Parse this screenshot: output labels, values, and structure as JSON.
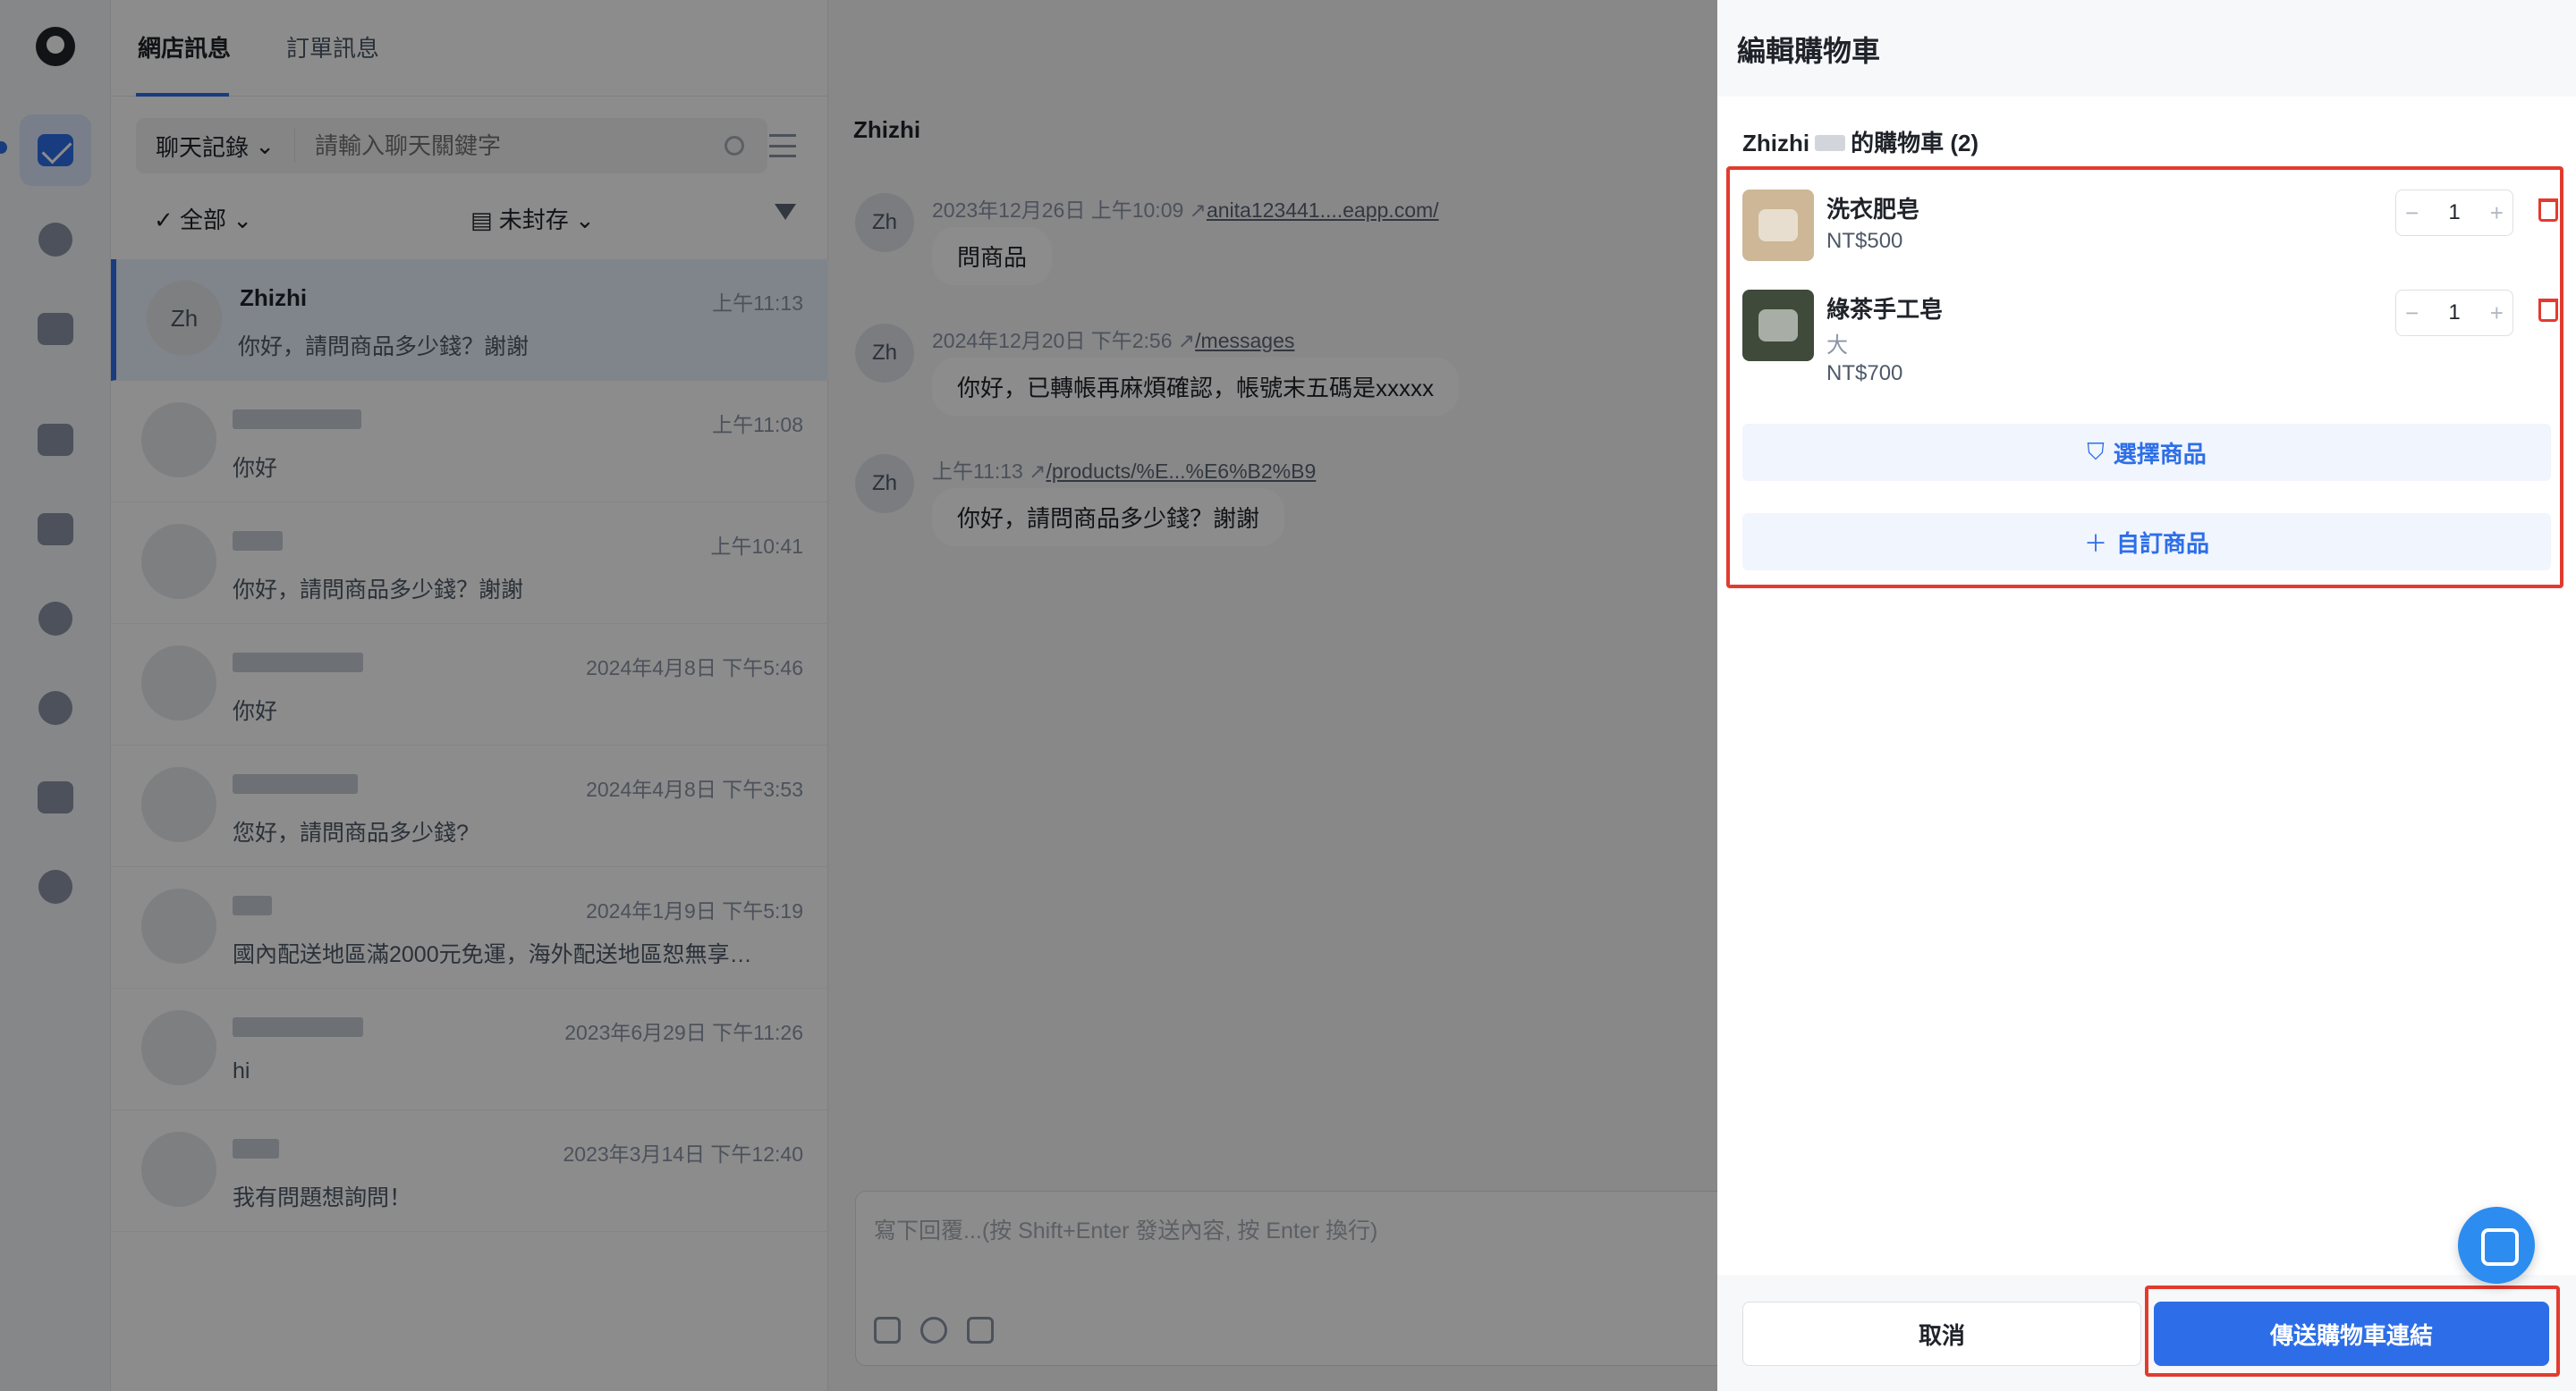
{
  "header": {
    "tabs": [
      {
        "label": "網店訊息"
      },
      {
        "label": "訂單訊息"
      }
    ]
  },
  "sidebar": {
    "items": [
      {
        "icon": "inbox-icon"
      },
      {
        "icon": "comment-icon"
      },
      {
        "icon": "image-icon"
      },
      {
        "icon": "robot-icon"
      },
      {
        "icon": "tag-icon"
      },
      {
        "icon": "bell-icon"
      },
      {
        "icon": "support-icon"
      },
      {
        "icon": "store-settings-icon"
      },
      {
        "icon": "more-icon"
      }
    ]
  },
  "search": {
    "scope": "聊天記錄",
    "placeholder": "請輸入聊天關鍵字"
  },
  "filters": {
    "all": "全部",
    "archive": "未封存"
  },
  "conversations": [
    {
      "initials": "Zh",
      "name": "Zhizhi",
      "time": "上午11:13",
      "message": "你好，請問商品多少錢？謝謝"
    },
    {
      "time": "上午11:08",
      "message": "你好"
    },
    {
      "time": "上午10:41",
      "message": "你好，請問商品多少錢？謝謝"
    },
    {
      "time": "2024年4月8日 下午5:46",
      "message": "你好"
    },
    {
      "time": "2024年4月8日 下午3:53",
      "message": "您好，請問商品多少錢?"
    },
    {
      "time": "2024年1月9日 下午5:19",
      "message": "國內配送地區滿2000元免運，海外配送地區恕無享…"
    },
    {
      "time": "2023年6月29日 下午11:26",
      "message": "hi"
    },
    {
      "time": "2023年3月14日 下午12:40",
      "message": "我有問題想詢問！"
    }
  ],
  "chat": {
    "contact": "Zhizhi",
    "messages": [
      {
        "initials": "Zh",
        "time": "2023年12月26日 上午10:09",
        "link": "anita123441....eapp.com/",
        "text": "問商品"
      },
      {
        "initials": "Zh",
        "time": "2024年12月20日 下午2:56",
        "link": "/messages",
        "text": "你好，已轉帳再麻煩確認，帳號末五碼是xxxxx"
      },
      {
        "initials": "Zh",
        "time": "上午11:13",
        "link": "/products/%E...%E6%B2%B9",
        "text": "你好，請問商品多少錢？謝謝"
      }
    ],
    "composer_placeholder": "寫下回覆...(按 Shift+Enter 發送內容, 按 Enter 換行)"
  },
  "drawer": {
    "title": "編輯購物車",
    "cart_name": "Zhizhi",
    "cart_suffix": "的購物車 (2)",
    "items": [
      {
        "name": "洗衣肥皂",
        "variant": "",
        "price": "NT$500",
        "qty": "1"
      },
      {
        "name": "綠茶手工皂",
        "variant": "大",
        "price": "NT$700",
        "qty": "1"
      }
    ],
    "select_product": "選擇商品",
    "custom_product": "自訂商品",
    "cancel": "取消",
    "send": "傳送購物車連結"
  },
  "colors": {
    "accent": "#2d6ee8",
    "highlight_box": "#e23b2e"
  }
}
